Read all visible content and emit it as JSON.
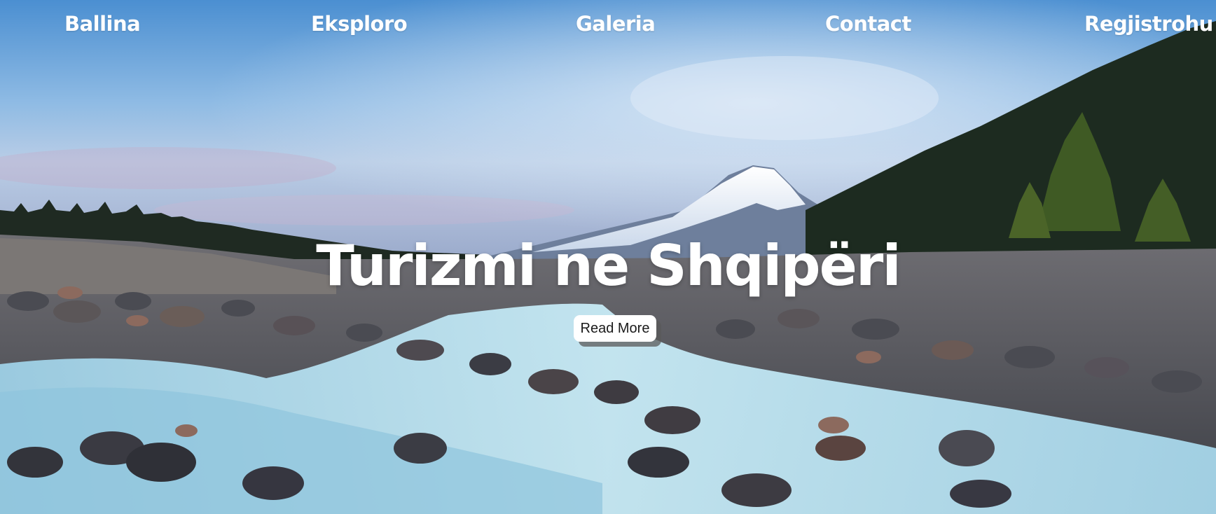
{
  "nav": {
    "items": [
      {
        "label": "Ballina"
      },
      {
        "label": "Eksploro"
      },
      {
        "label": "Galeria"
      },
      {
        "label": "Contact"
      },
      {
        "label": "Regjistrohu"
      }
    ]
  },
  "hero": {
    "title": "Turizmi ne Shqipëri",
    "button_label": "Read More",
    "background_icon": "mountain-river-landscape"
  },
  "colors": {
    "nav_text": "#ffffff",
    "title_text": "#ffffff",
    "button_bg": "#ffffff",
    "button_text": "#1a1a1a"
  }
}
